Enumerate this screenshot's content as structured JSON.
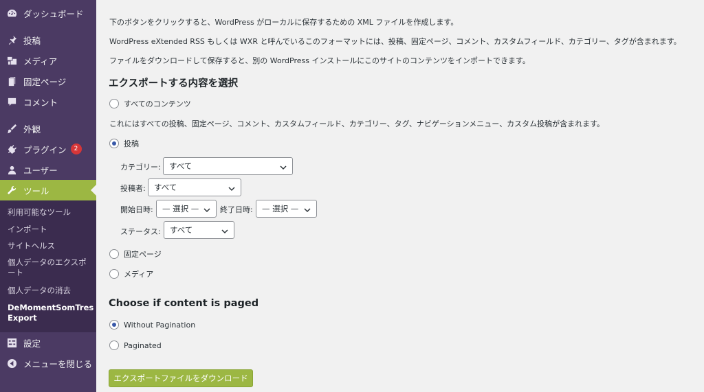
{
  "sidebar": {
    "menu": [
      {
        "label": "ダッシュボード",
        "icon": "dashboard-icon"
      },
      {
        "label": "投稿",
        "icon": "pin-icon"
      },
      {
        "label": "メディア",
        "icon": "media-icon"
      },
      {
        "label": "固定ページ",
        "icon": "page-icon"
      },
      {
        "label": "コメント",
        "icon": "comment-icon"
      },
      {
        "label": "外観",
        "icon": "appearance-icon"
      },
      {
        "label": "プラグイン",
        "icon": "plugin-icon",
        "badge": "2"
      },
      {
        "label": "ユーザー",
        "icon": "user-icon"
      },
      {
        "label": "ツール",
        "icon": "wrench-icon"
      },
      {
        "label": "設定",
        "icon": "settings-icon"
      },
      {
        "label": "メニューを閉じる",
        "icon": "collapse-icon"
      }
    ],
    "submenu": [
      {
        "label": "利用可能なツール"
      },
      {
        "label": "インポート"
      },
      {
        "label": "サイトヘルス"
      },
      {
        "label": "個人データのエクスポート"
      },
      {
        "label": "個人データの消去"
      },
      {
        "label": "DeMomentSomTres Export"
      }
    ]
  },
  "intro": {
    "p1": "下のボタンをクリックすると、WordPress がローカルに保存するための XML ファイルを作成します。",
    "p2": "WordPress eXtended RSS もしくは WXR と呼んでいるこのフォーマットには、投稿、固定ページ、コメント、カスタムフィールド、カテゴリー、タグが含まれます。",
    "p3": "ファイルをダウンロードして保存すると、別の WordPress インストールにこのサイトのコンテンツをインポートできます。"
  },
  "export_section": {
    "heading": "エクスポートする内容を選択",
    "all_content_label": "すべてのコンテンツ",
    "all_content_desc": "これにはすべての投稿、固定ページ、コメント、カスタムフィールド、カテゴリー、タグ、ナビゲーションメニュー、カスタム投稿が含まれます。",
    "posts_label": "投稿",
    "category_label": "カテゴリー:",
    "category_value": "すべて",
    "author_label": "投稿者:",
    "author_value": "すべて",
    "start_date_label": "開始日時:",
    "start_date_value": "— 選択 —",
    "end_date_label": "終了日時:",
    "end_date_value": "— 選択 —",
    "status_label": "ステータス:",
    "status_value": "すべて",
    "pages_label": "固定ページ",
    "media_label": "メディア",
    "selected": "posts"
  },
  "paged_section": {
    "heading": "Choose if content is paged",
    "without_label": "Without Pagination",
    "paginated_label": "Paginated",
    "selected": "without"
  },
  "download_button": "エクスポートファイルをダウンロード",
  "colors": {
    "sidebar_bg": "#4b3a63",
    "submenu_bg": "#3b2c4f",
    "accent": "#9cb743",
    "badge": "#d63638"
  }
}
